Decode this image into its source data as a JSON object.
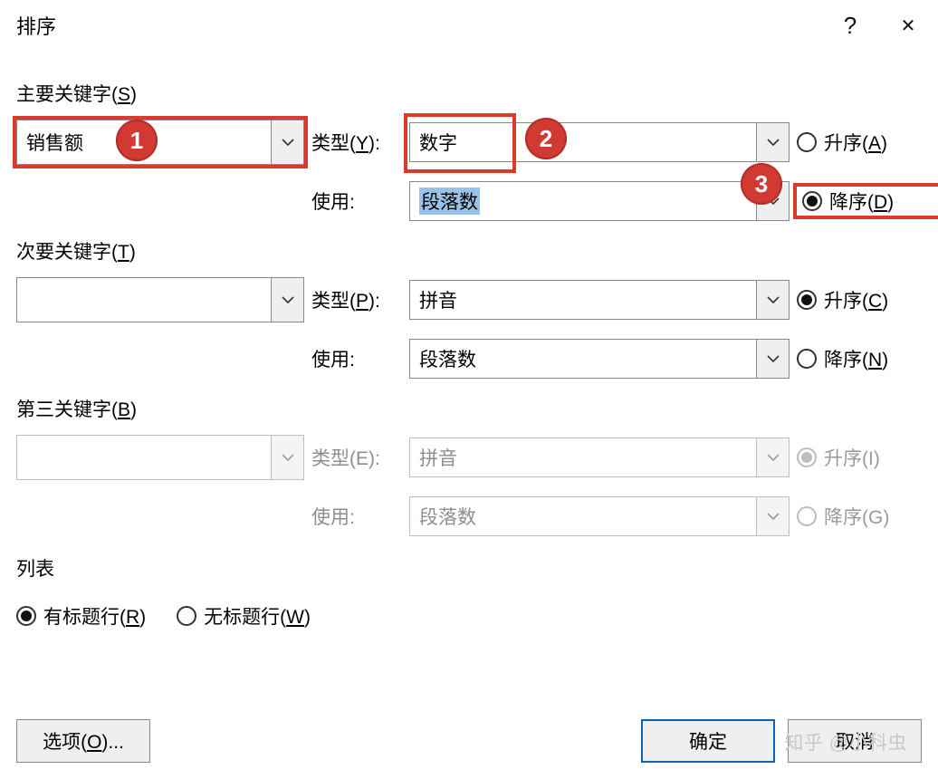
{
  "window": {
    "title": "排序",
    "help_glyph": "?",
    "close_glyph": "✕"
  },
  "primary": {
    "heading": "主要关键字(",
    "heading_accel": "S",
    "heading_tail": ")",
    "field_value": "销售额",
    "type_label_pre": "类型(",
    "type_accel": "Y",
    "type_label_post": "):",
    "type_value": "数字",
    "use_label": "使用:",
    "use_value": "段落数",
    "asc_label_pre": "升序(",
    "asc_accel": "A",
    "asc_label_post": ")",
    "desc_label_pre": "降序(",
    "desc_accel": "D",
    "desc_label_post": ")",
    "order_selected": "desc"
  },
  "secondary": {
    "heading": "次要关键字(",
    "heading_accel": "T",
    "heading_tail": ")",
    "field_value": "",
    "type_label_pre": "类型(",
    "type_accel": "P",
    "type_label_post": "):",
    "type_value": "拼音",
    "use_label": "使用:",
    "use_value": "段落数",
    "asc_label_pre": "升序(",
    "asc_accel": "C",
    "asc_label_post": ")",
    "desc_label_pre": "降序(",
    "desc_accel": "N",
    "desc_label_post": ")",
    "order_selected": "asc"
  },
  "tertiary": {
    "heading": "第三关键字(",
    "heading_accel": "B",
    "heading_tail": ")",
    "field_value": "",
    "type_label": "类型(E):",
    "type_value": "拼音",
    "use_label": "使用:",
    "use_value": "段落数",
    "asc_label": "升序(I)",
    "desc_label": "降序(G)",
    "disabled": true
  },
  "list_section": {
    "heading": "列表",
    "has_header_label_pre": "有标题行(",
    "has_header_accel": "R",
    "has_header_label_post": ")",
    "no_header_label_pre": "无标题行(",
    "no_header_accel": "W",
    "no_header_label_post": ")",
    "selected": "has_header"
  },
  "buttons": {
    "options_pre": "选项(",
    "options_accel": "O",
    "options_post": ")...",
    "ok": "确定",
    "cancel": "取消"
  },
  "annotations": {
    "badge1": "1",
    "badge2": "2",
    "badge3": "3"
  },
  "watermark": "知乎 @小科虫"
}
